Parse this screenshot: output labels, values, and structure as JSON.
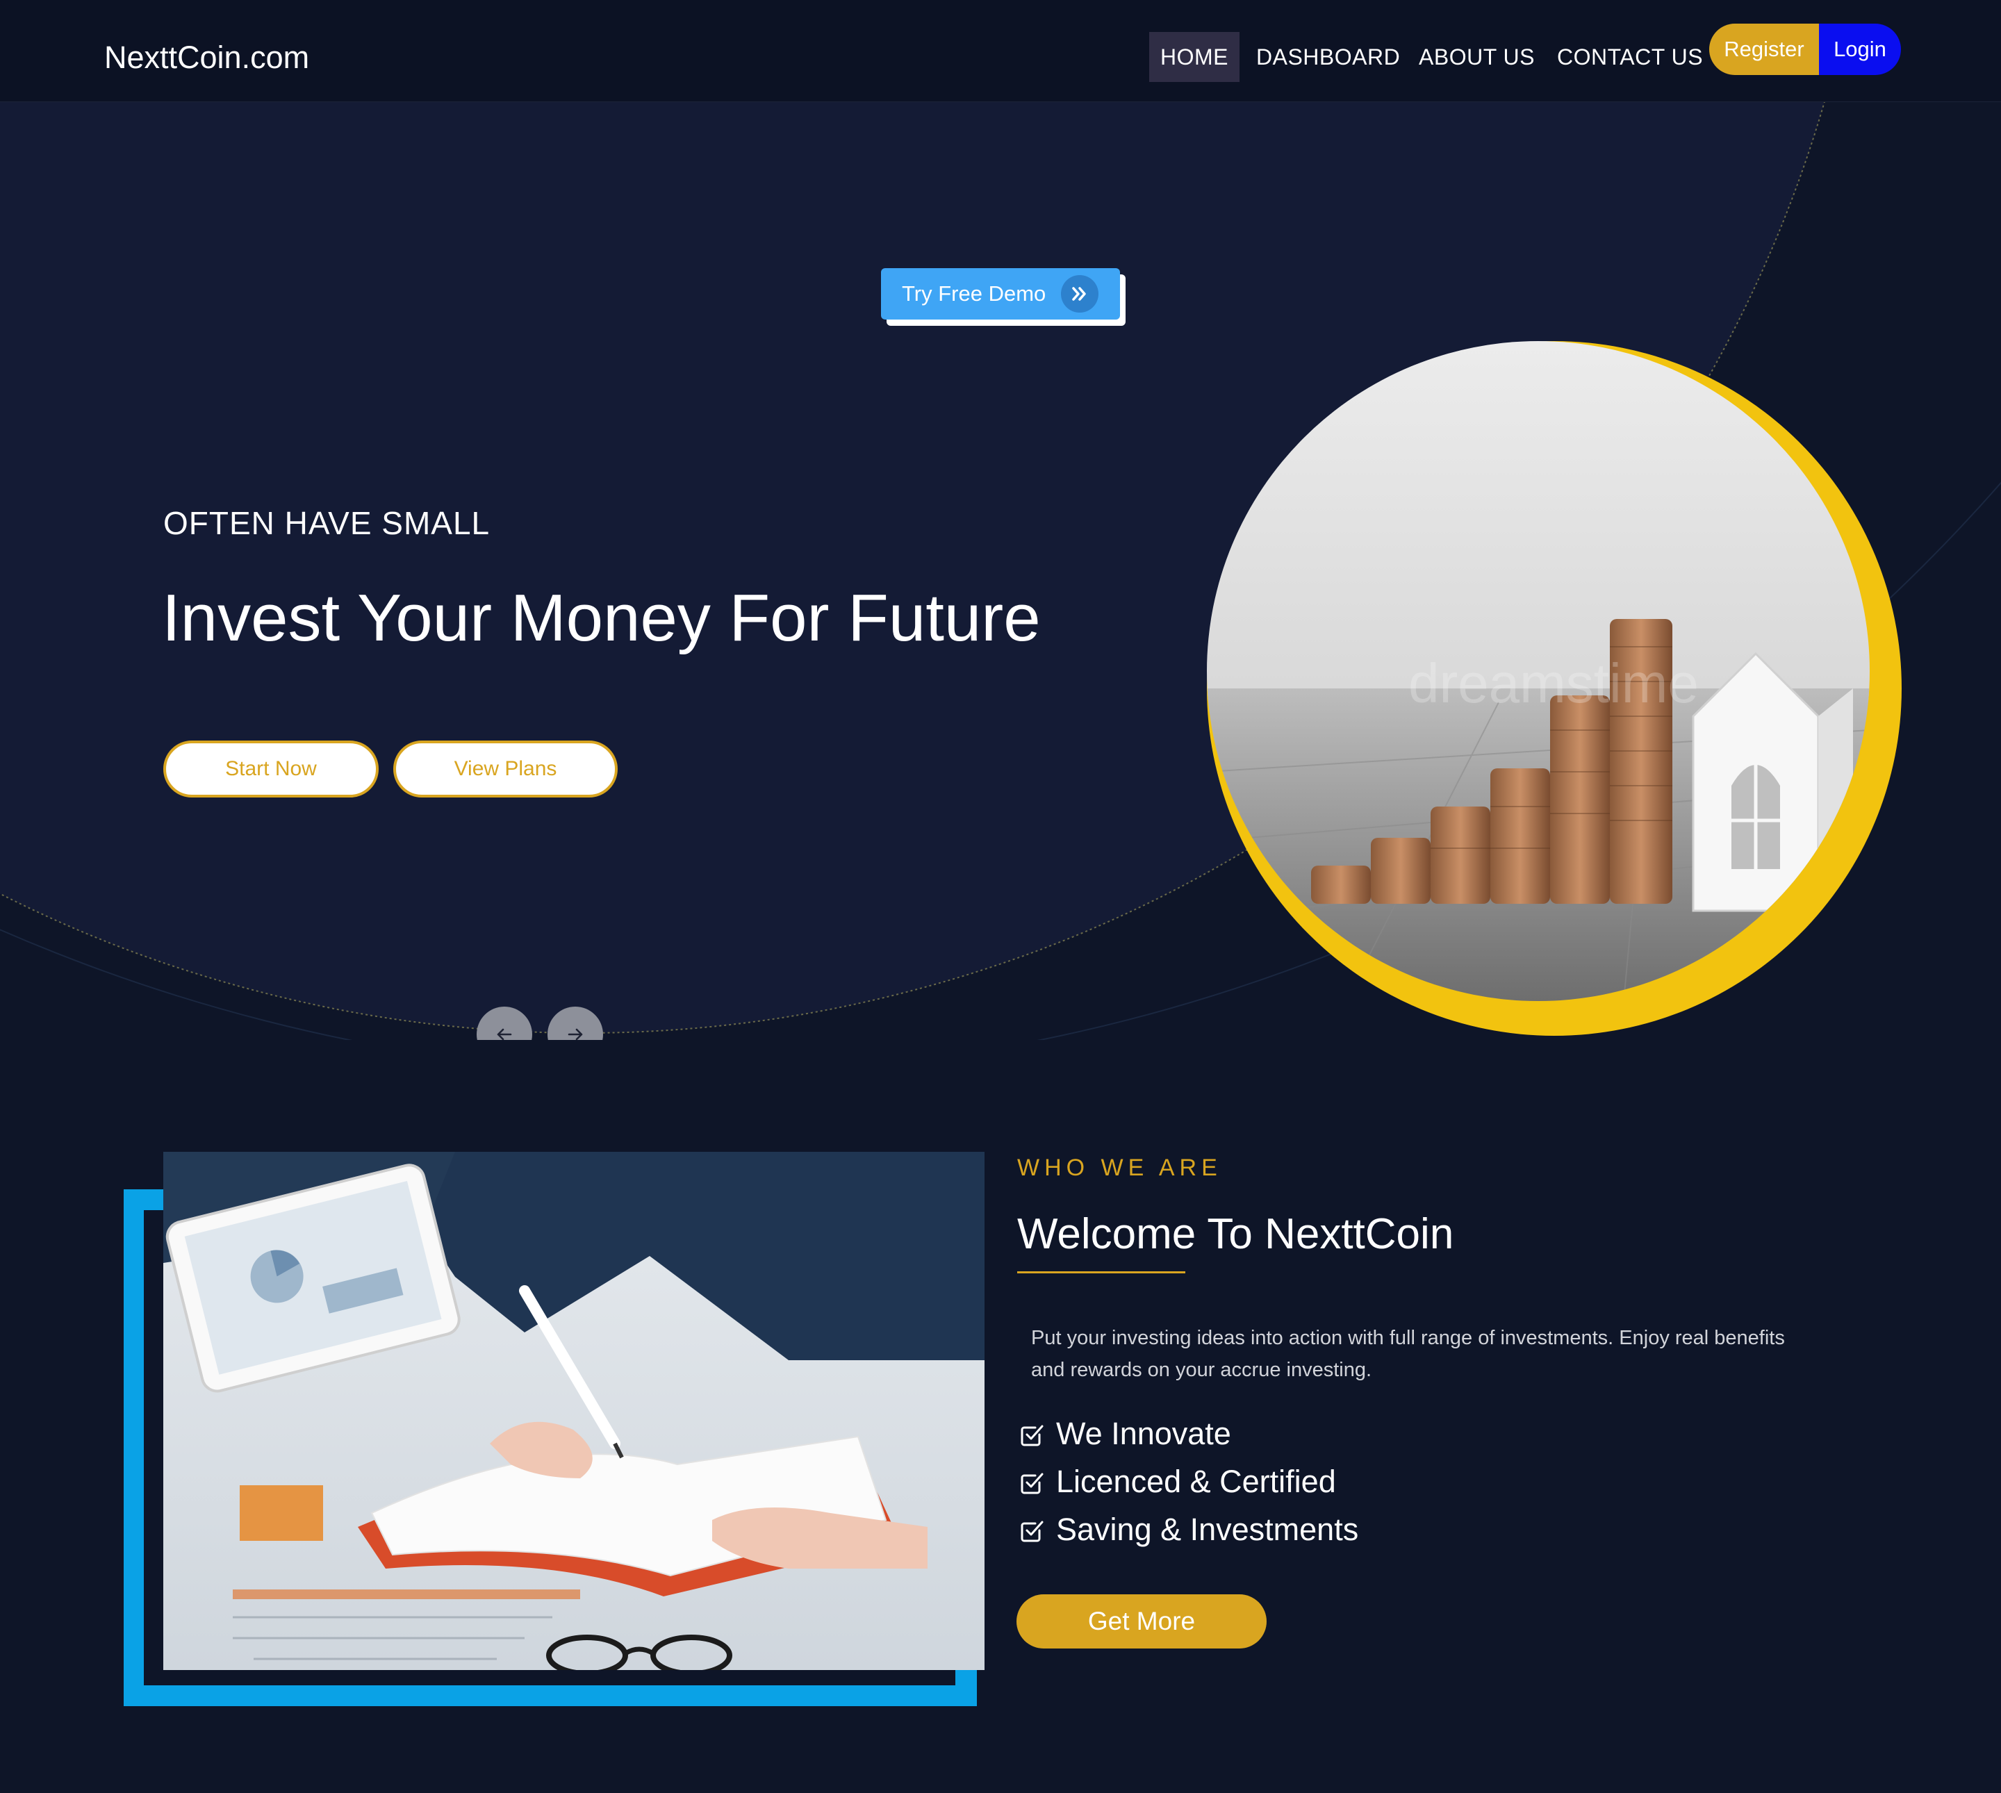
{
  "nav": {
    "brand": "NexttCoin.com",
    "links": [
      "HOME",
      "DASHBOARD",
      "ABOUT US",
      "CONTACT US"
    ],
    "register": "Register",
    "login": "Login"
  },
  "hero": {
    "demo_button": "Try Free Demo",
    "kicker": "OFTEN HAVE SMALL",
    "title": "Invest Your Money For Future",
    "start_button": "Start Now",
    "plans_button": "View Plans",
    "image_watermark": "dreamstime"
  },
  "about": {
    "kicker": "WHO WE ARE",
    "title": "Welcome To NexttCoin",
    "text": "Put your investing ideas into action with full range of investments. Enjoy real benefits and rewards on your accrue investing.",
    "features": [
      "We Innovate",
      "Licenced & Certified",
      "Saving & Investments"
    ],
    "cta": "Get More"
  },
  "colors": {
    "page_bg": "#0e1528",
    "hero_bg": "#141b35",
    "accent_gold": "#d9a520",
    "ring_yellow": "#f2c30f",
    "login_blue": "#0a0ef0",
    "demo_blue": "#3fa5f5",
    "frame_blue": "#0aa2e6"
  },
  "icons": [
    "chevrons-right-icon",
    "arrow-left-icon",
    "arrow-right-icon",
    "checkbox-icon"
  ]
}
